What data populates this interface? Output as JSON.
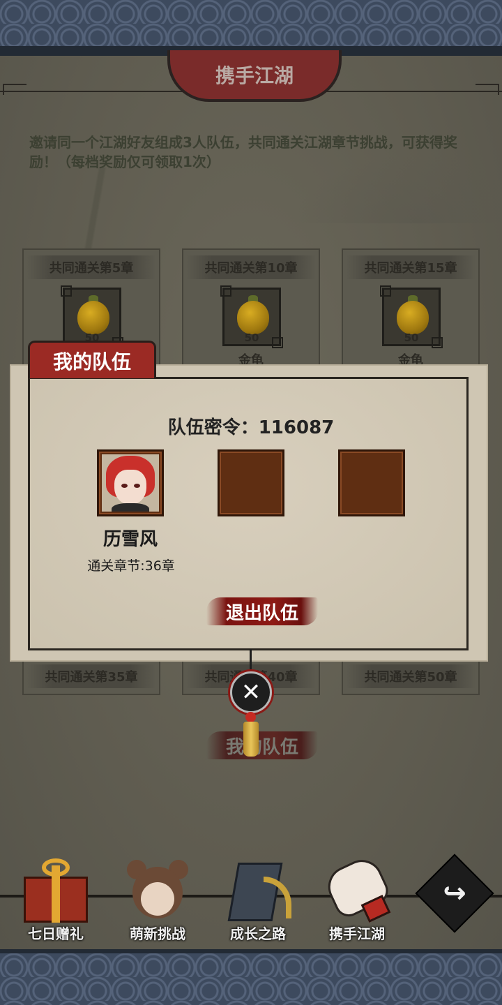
{
  "header": {
    "title": "携手江湖"
  },
  "intro": {
    "text": "邀请同一个江湖好友组成3人队伍，共同通关江湖章节挑战，可获得奖励！（每档奖励仅可领取1次）"
  },
  "reward_cards_top": [
    {
      "title": "共同通关第5章",
      "item_name": "金龟",
      "qty": "50"
    },
    {
      "title": "共同通关第10章",
      "item_name": "金龟",
      "qty": "50"
    },
    {
      "title": "共同通关第15章",
      "item_name": "金龟",
      "qty": "50"
    }
  ],
  "reward_cards_bottom": [
    {
      "title": "共同通关第35章"
    },
    {
      "title": "共同通关第40章"
    },
    {
      "title": "共同通关第50章"
    }
  ],
  "modal": {
    "tab_title": "我的队伍",
    "team_code_label": "队伍密令：116087",
    "member": {
      "name": "历雪风",
      "progress": "通关章节:36章"
    },
    "exit_button": "退出队伍"
  },
  "my_team_button": "我的队伍",
  "bottom_nav": [
    {
      "label": "七日赠礼",
      "icon": "gift-box-icon"
    },
    {
      "label": "萌新挑战",
      "icon": "girl-avatar-icon"
    },
    {
      "label": "成长之路",
      "icon": "book-arrow-icon"
    },
    {
      "label": "携手江湖",
      "icon": "handshake-icon"
    }
  ],
  "colors": {
    "accent_red": "#9b2a24",
    "panel_bg": "#5f5c50",
    "parchment": "#cfc6b3"
  }
}
